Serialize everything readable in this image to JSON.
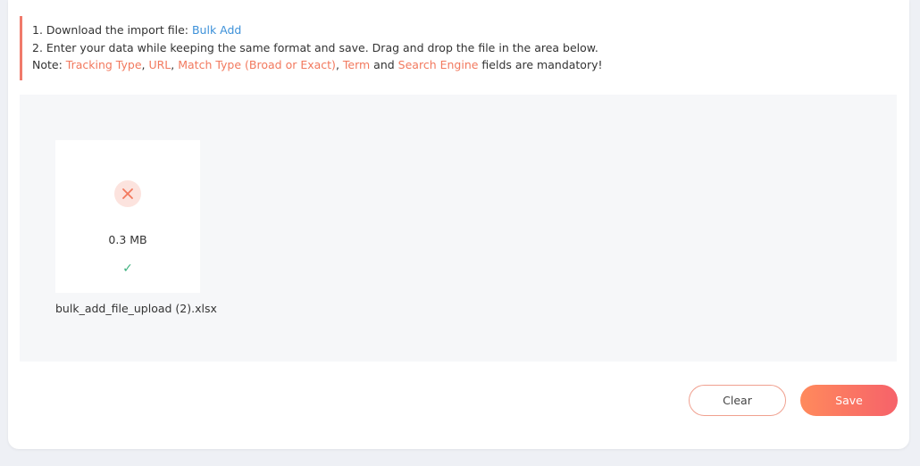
{
  "instructions": {
    "line1_prefix": "1. Download the import file: ",
    "line1_link": "Bulk Add",
    "line2": "2. Enter your data while keeping the same format and save. Drag and drop the file in the area below.",
    "note_prefix": "Note: ",
    "field_tracking_type": "Tracking Type",
    "sep1": ", ",
    "field_url": "URL",
    "sep2": ", ",
    "field_match_type": "Match Type (Broad or Exact)",
    "sep3": ", ",
    "field_term": "Term",
    "and_text": " and ",
    "field_search_engine": "Search Engine",
    "note_suffix": " fields are mandatory!"
  },
  "upload": {
    "file_size": "0.3 MB",
    "file_name": "bulk_add_file_upload (2).xlsx",
    "status_icon": "close-icon",
    "done_icon": "check-icon",
    "check_glyph": "✓"
  },
  "actions": {
    "clear_label": "Clear",
    "save_label": "Save"
  },
  "colors": {
    "accent_orange": "#f2795e",
    "link_blue": "#3d91d9",
    "success_green": "#3fb27f",
    "save_gradient_start": "#ff8a5c",
    "save_gradient_end": "#f6626a"
  }
}
